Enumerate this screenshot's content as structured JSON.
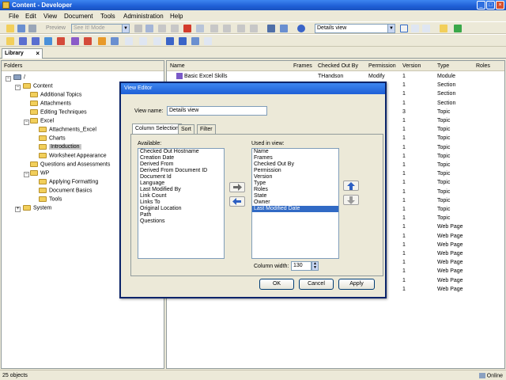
{
  "window": {
    "title": "Content - Developer"
  },
  "menu": [
    "File",
    "Edit",
    "View",
    "Document",
    "Tools",
    "Administration",
    "Help"
  ],
  "toolbar": {
    "preview_label": "Preview",
    "mode_combo": "See It! Mode",
    "view_combo": "Details view"
  },
  "library_tab": {
    "label": "Library"
  },
  "folders": {
    "header": "Folders",
    "root": "/",
    "items": [
      "Content",
      "Additional Topics",
      "Attachments",
      "Editing Techniques",
      "Excel",
      "Attachments_Excel",
      "Charts",
      "Introduction",
      "Worksheet Appearance",
      "Questions and Assessments",
      "WP",
      "Applying Formatting",
      "Document Basics",
      "Tools",
      "System"
    ]
  },
  "list": {
    "columns": [
      "Name",
      "Frames",
      "Checked Out By",
      "Permission",
      "Version",
      "Type",
      "Roles"
    ],
    "first_row": {
      "name": "Basic Excel Skills",
      "checked_out_by": "THandson",
      "permission": "Modify",
      "version": "1",
      "type": "Module"
    },
    "versions": [
      "1",
      "1",
      "1",
      "1",
      "3",
      "1",
      "1",
      "1",
      "1",
      "1",
      "1",
      "1",
      "1",
      "1",
      "1",
      "1",
      "1",
      "1",
      "1",
      "1",
      "1",
      "1",
      "1",
      "1",
      "1"
    ],
    "types": [
      "Module",
      "Section",
      "Section",
      "Section",
      "Topic",
      "Topic",
      "Topic",
      "Topic",
      "Topic",
      "Topic",
      "Topic",
      "Topic",
      "Topic",
      "Topic",
      "Topic",
      "Topic",
      "Topic",
      "Web Page",
      "Web Page",
      "Web Page",
      "Web Page",
      "Web Page",
      "Web Page",
      "Web Page",
      "Web Page"
    ]
  },
  "status": {
    "objects": "25 objects",
    "connection": "Online"
  },
  "dialog": {
    "title": "View Editor",
    "view_name_label": "View name:",
    "view_name_value": "Details view",
    "tabs": [
      "Column Selection",
      "Sort",
      "Filter"
    ],
    "available_label": "Available:",
    "available": [
      "Checked Out Hostname",
      "Creation Date",
      "Derived From",
      "Derived From Document ID",
      "Document Id",
      "Language",
      "Last Modified By",
      "Link Count",
      "Links To",
      "Original Location",
      "Path",
      "Questions"
    ],
    "used_label": "Used in view:",
    "used": [
      "Name",
      "Frames",
      "Checked Out By",
      "Permission",
      "Version",
      "Type",
      "Roles",
      "State",
      "Owner",
      "Last Modified Date"
    ],
    "selected_used": "Last Modified Date",
    "column_width_label": "Column width:",
    "column_width_value": "130",
    "ok_label": "OK",
    "cancel_label": "Cancel",
    "apply_label": "Apply"
  }
}
